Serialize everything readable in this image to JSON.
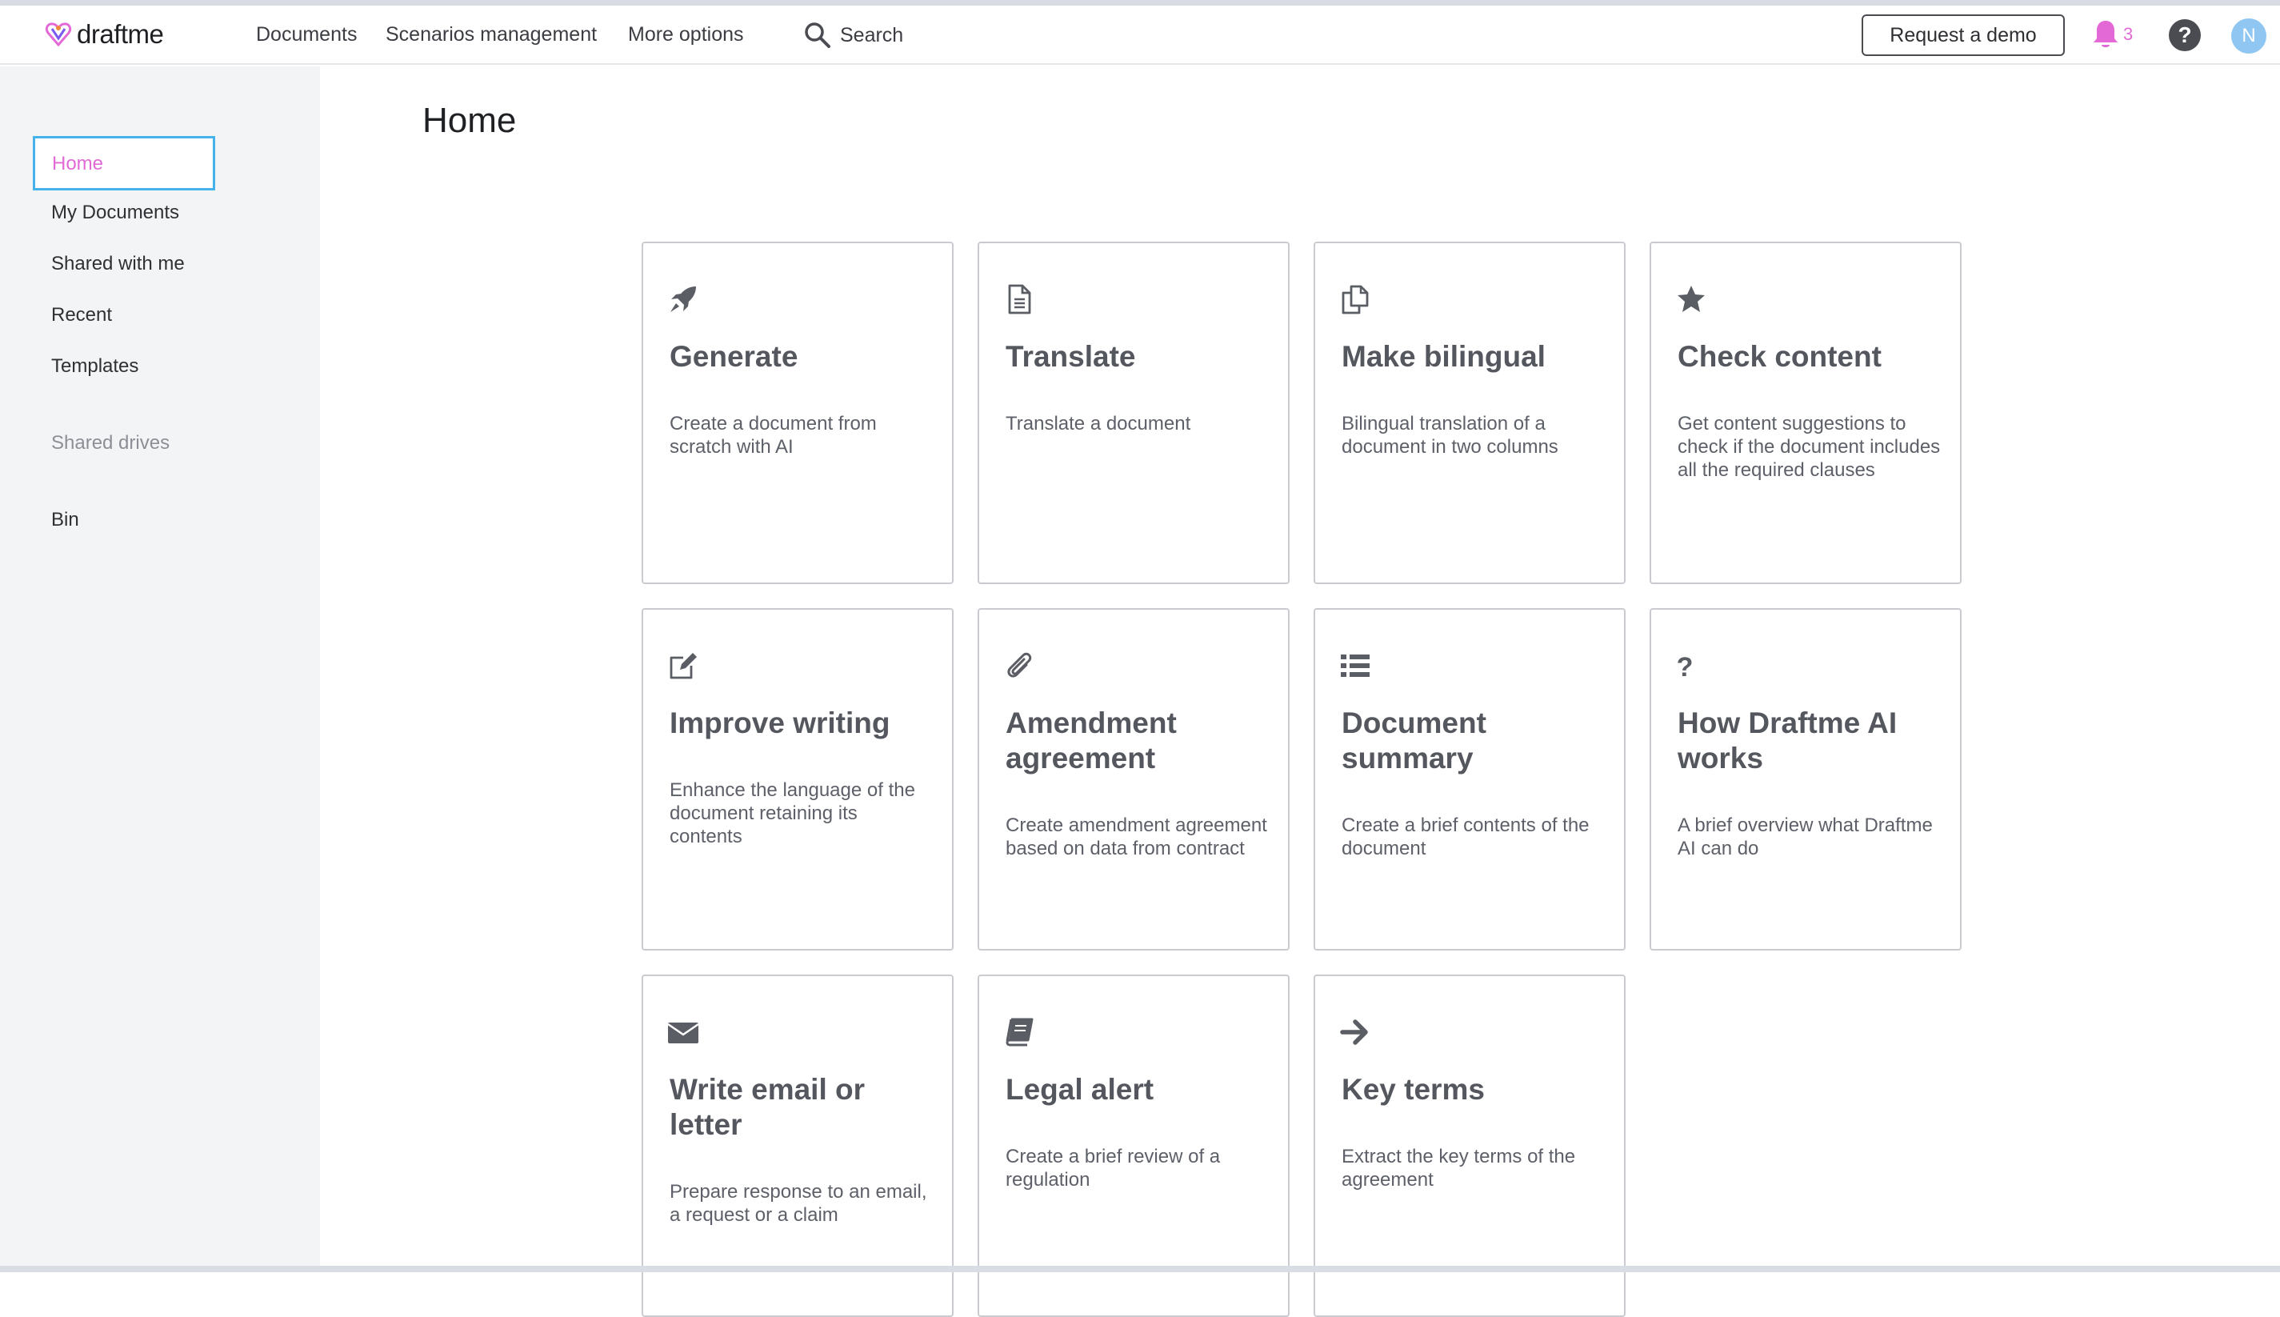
{
  "header": {
    "logo_text": "draftme",
    "nav": [
      "Documents",
      "Scenarios management",
      "More options"
    ],
    "search_label": "Search",
    "demo_button": "Request a demo",
    "notification_count": "3",
    "avatar_initial": "N",
    "accent_color": "#e36ad6",
    "avatar_color": "#8fc6f2"
  },
  "sidebar": {
    "home": "Home",
    "items": [
      "My Documents",
      "Shared with me",
      "Recent",
      "Templates"
    ],
    "shared_drives": "Shared drives",
    "bin": "Bin"
  },
  "main": {
    "title": "Home",
    "cards": [
      {
        "icon": "rocket-icon",
        "title": "Generate",
        "description": "Create a document from scratch with AI"
      },
      {
        "icon": "document-icon",
        "title": "Translate",
        "description": "Translate a document"
      },
      {
        "icon": "copy-icon",
        "title": "Make bilingual",
        "description": "Bilingual translation of a document in two columns"
      },
      {
        "icon": "star-icon",
        "title": "Check content",
        "description": "Get content suggestions to check if the document includes all the required clauses"
      },
      {
        "icon": "edit-icon",
        "title": "Improve writing",
        "description": "Enhance the language of the document retaining its contents"
      },
      {
        "icon": "paperclip-icon",
        "title": "Amendment agreement",
        "description": "Create amendment agreement based on data from contract"
      },
      {
        "icon": "list-icon",
        "title": "Document summary",
        "description": "Create a brief contents of the document"
      },
      {
        "icon": "question-icon",
        "title": "How Draftme AI works",
        "description": "A brief overview what Draftme AI can do"
      },
      {
        "icon": "envelope-icon",
        "title": "Write email or letter",
        "description": "Prepare response to an email, a request or a claim"
      },
      {
        "icon": "book-icon",
        "title": "Legal alert",
        "description": "Create a brief review of a regulation"
      },
      {
        "icon": "arrow-right-icon",
        "title": "Key terms",
        "description": "Extract the key terms of the agreement"
      }
    ]
  }
}
